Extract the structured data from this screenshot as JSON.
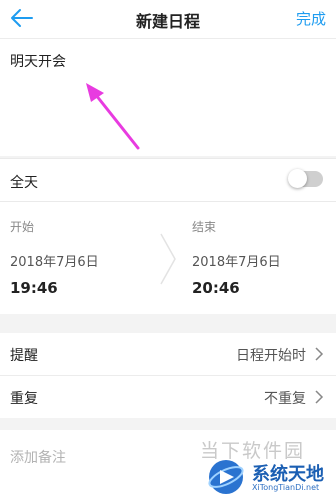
{
  "header": {
    "title": "新建日程",
    "done_label": "完成"
  },
  "event": {
    "title": "明天开会"
  },
  "all_day": {
    "label": "全天",
    "enabled": false
  },
  "start": {
    "label": "开始",
    "date": "2018年7月6日",
    "time": "19:46"
  },
  "end": {
    "label": "结束",
    "date": "2018年7月6日",
    "time": "20:46"
  },
  "reminder": {
    "label": "提醒",
    "value": "日程开始时"
  },
  "repeat": {
    "label": "重复",
    "value": "不重复"
  },
  "notes": {
    "placeholder": "添加备注"
  },
  "watermark": {
    "text1": "当下软件园",
    "text2": "系统天地",
    "text3": "XiTongTianDi.net"
  },
  "colors": {
    "accent": "#1e9cf0",
    "annotation_arrow": "#e83be0"
  }
}
